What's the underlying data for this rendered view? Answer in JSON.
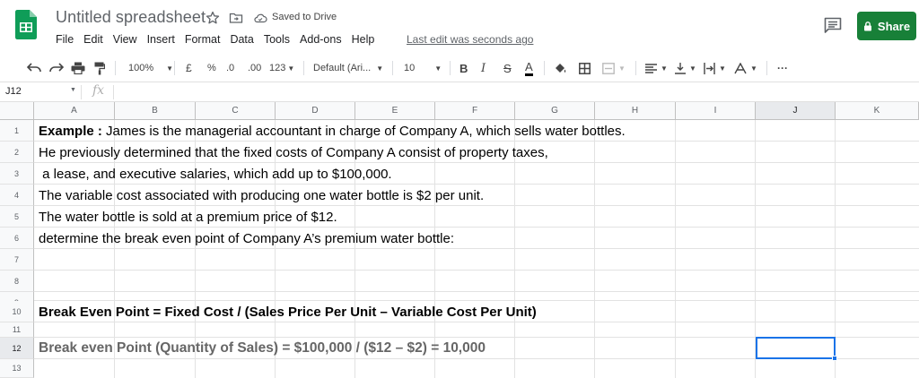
{
  "app": {
    "doc_title": "Untitled spreadsheet",
    "saved_status": "Saved to Drive",
    "last_edit": "Last edit was seconds ago",
    "share_label": "Share",
    "brand_color": "#0f9d58",
    "share_color": "#188038"
  },
  "menu": [
    "File",
    "Edit",
    "View",
    "Insert",
    "Format",
    "Data",
    "Tools",
    "Add-ons",
    "Help"
  ],
  "toolbar": {
    "zoom": "100%",
    "currency": "£",
    "percent": "%",
    "dec_less": ".0",
    "dec_more": ".00",
    "more_formats": "123",
    "font": "Default (Ari...",
    "font_size": "10",
    "more": "···"
  },
  "formula_bar": {
    "cell_ref": "J12",
    "fx": "fx",
    "value": ""
  },
  "columns": [
    "A",
    "B",
    "C",
    "D",
    "E",
    "F",
    "G",
    "H",
    "I",
    "J",
    "K"
  ],
  "rows": [
    "1",
    "2",
    "3",
    "4",
    "5",
    "6",
    "7",
    "8",
    "9",
    "10",
    "11",
    "12",
    "13"
  ],
  "selected_cell": "J12",
  "cells": {
    "r1_bold": "Example :",
    "r1": " James is the managerial accountant in charge of Company A, which sells water bottles.",
    "r2": "He previously determined that the fixed costs of Company A consist of property taxes,",
    "r3": " a lease, and executive salaries, which add up to $100,000.",
    "r4": "The variable cost associated with producing one water bottle is $2 per unit.",
    "r5": "The water bottle is sold at a premium price of $12.",
    "r6": "determine the break even point of Company A’s premium water bottle:",
    "r10": "Break Even Point = Fixed Cost / (Sales Price Per Unit – Variable Cost Per Unit)",
    "r12": "Break even Point (Quantity of Sales) = $100,000 / ($12 – $2) = 10,000"
  }
}
